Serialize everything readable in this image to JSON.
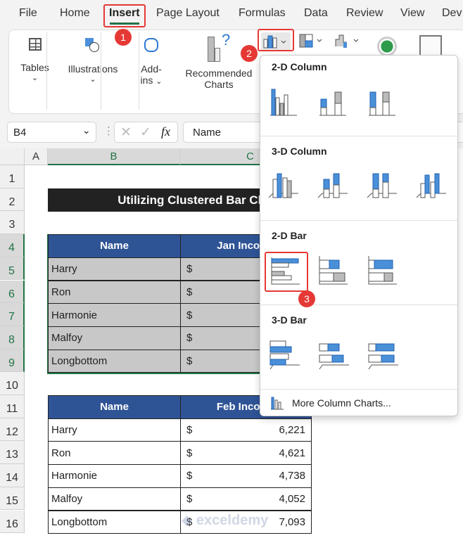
{
  "menu": {
    "tabs": [
      "File",
      "Home",
      "Insert",
      "Page Layout",
      "Formulas",
      "Data",
      "Review",
      "View",
      "Dev"
    ],
    "active": "Insert"
  },
  "ribbon": {
    "tables": "Tables",
    "illustrations": "Illustrations",
    "addins_1": "Add-",
    "addins_2": "ins",
    "recommended_1": "Recommended",
    "recommended_2": "Charts"
  },
  "formula_bar": {
    "name_box": "B4",
    "formula": "Name",
    "fx": "fx"
  },
  "columns": [
    "A",
    "B",
    "C"
  ],
  "rows": [
    "1",
    "2",
    "3",
    "4",
    "5",
    "6",
    "7",
    "8",
    "9",
    "10",
    "11",
    "12",
    "13",
    "14",
    "15",
    "16"
  ],
  "title": "Utilizing Clustered Bar Chart",
  "table1": {
    "headers": [
      "Name",
      "Jan Income"
    ],
    "rows": [
      {
        "name": "Harry",
        "cur": "$"
      },
      {
        "name": "Ron",
        "cur": "$"
      },
      {
        "name": "Harmonie",
        "cur": "$"
      },
      {
        "name": "Malfoy",
        "cur": "$"
      },
      {
        "name": "Longbottom",
        "cur": "$"
      }
    ]
  },
  "table2": {
    "headers": [
      "Name",
      "Feb Income"
    ],
    "rows": [
      {
        "name": "Harry",
        "cur": "$",
        "value": "6,221"
      },
      {
        "name": "Ron",
        "cur": "$",
        "value": "4,621"
      },
      {
        "name": "Harmonie",
        "cur": "$",
        "value": "4,738"
      },
      {
        "name": "Malfoy",
        "cur": "$",
        "value": "4,052"
      },
      {
        "name": "Longbottom",
        "cur": "$",
        "value": "7,093"
      }
    ]
  },
  "dropdown": {
    "sections": [
      "2-D Column",
      "3-D Column",
      "2-D Bar",
      "3-D Bar"
    ],
    "more": "More Column Charts..."
  },
  "steps": [
    "1",
    "2",
    "3"
  ],
  "watermark": "exceldemy EXCEL · DATA · BI",
  "colors": {
    "header": "#2f5496",
    "accent": "#e53935",
    "selection": "#217346"
  }
}
